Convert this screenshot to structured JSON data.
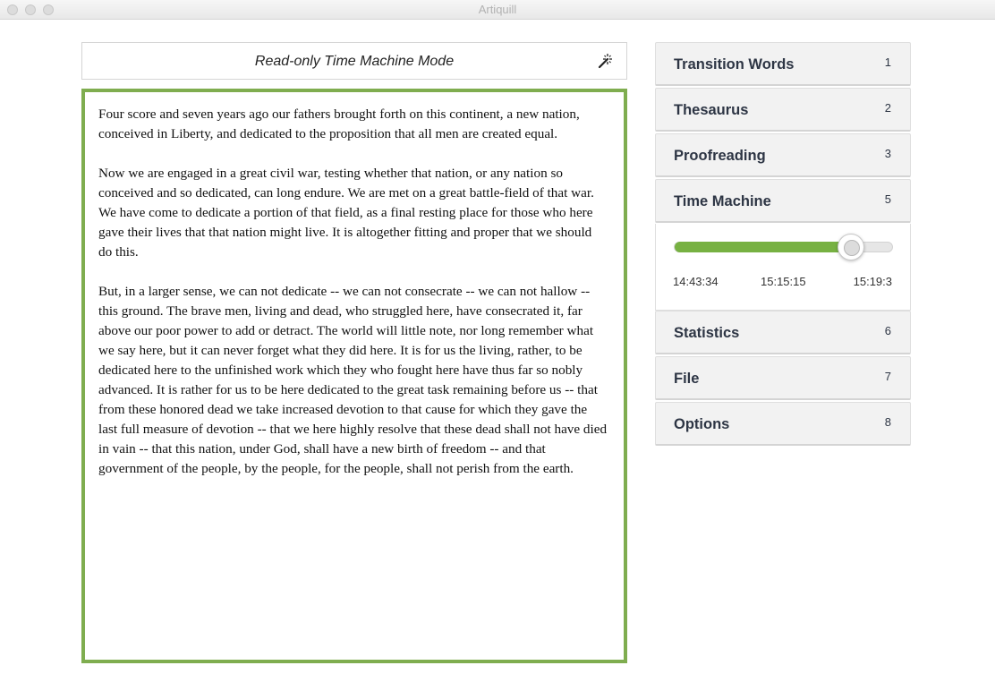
{
  "window": {
    "title": "Artiquill"
  },
  "mode_bar": {
    "label": "Read-only Time Machine Mode",
    "icon": "magic-wand-icon"
  },
  "editor": {
    "paragraphs": [
      "Four score and seven years ago our fathers brought forth on this continent, a new nation, conceived in Liberty, and dedicated to the proposition that all men are created equal.",
      "Now we are engaged in a great civil war, testing whether that nation, or any nation so conceived and so dedicated, can long endure. We are met on a great battle-field of that war. We have come to dedicate a portion of that field, as a final resting place for those who here gave their lives that that nation might live. It is altogether fitting and proper that we should do this.",
      "But, in a larger sense, we can not dedicate -- we can not consecrate -- we can not hallow -- this ground. The brave men, living and dead, who struggled here, have consecrated it, far above our poor power to add or detract. The world will little note, nor long remember what we say here, but it can never forget what they did here. It is for us the living, rather, to be dedicated here to the unfinished work which they who fought here have thus far so nobly advanced. It is rather for us to be here dedicated to the great task remaining before us -- that from these honored dead we take increased devotion to that cause for which they gave the last full measure of devotion -- that we here highly resolve that these dead shall not have died in vain -- that this nation, under God, shall have a new birth of freedom -- and that government of the people, by the people, for the people, shall not perish from the earth."
    ],
    "border_color": "#7fad4f"
  },
  "sidebar": {
    "items": [
      {
        "label": "Transition Words",
        "shortcut": "1"
      },
      {
        "label": "Thesaurus",
        "shortcut": "2"
      },
      {
        "label": "Proofreading",
        "shortcut": "3"
      },
      {
        "label": "Time Machine",
        "shortcut": "5"
      },
      {
        "label": "Statistics",
        "shortcut": "6"
      },
      {
        "label": "File",
        "shortcut": "7"
      },
      {
        "label": "Options",
        "shortcut": "8"
      }
    ]
  },
  "time_machine": {
    "slider_fraction": 0.81,
    "fill_color": "#77b142",
    "ticks": [
      "14:43:34",
      "15:15:15",
      "15:19:3"
    ]
  }
}
